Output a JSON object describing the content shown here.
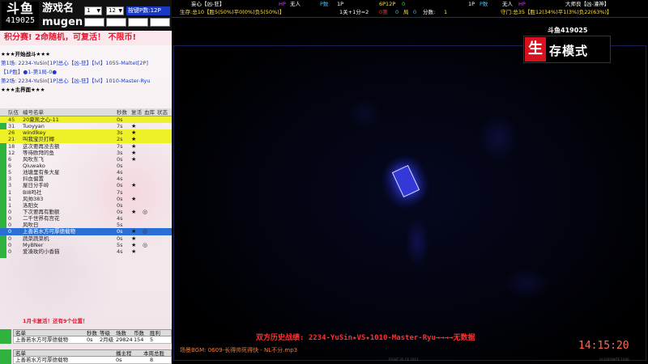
{
  "left_panel": {
    "logo_main": "斗鱼",
    "logo_num": "419025",
    "game_label": "游戏名",
    "engine_label": "mugen",
    "select_a": "1",
    "select_b": "12",
    "hotkey_label": "按键P数:12P",
    "options": [
      "",
      "",
      "",
      ""
    ],
    "score_banner": "积分赛! 2命随机，可复活！ 不限币!",
    "log_lines": [
      {
        "text": "★★★开始战斗★★★",
        "style": "black"
      },
      {
        "text": "第1场: 2234-YuSin[1P]总心【凶-狂】【lvl】1055-Maltet[2P]",
        "style": "blue"
      },
      {
        "text": "【1P胜】●1-第1局-0●",
        "style": "blue"
      },
      {
        "text": "第2场: 2234-YuSin[1P]总心【凶-狂】【lvl】1010-Master-Ryu",
        "style": "blue"
      },
      {
        "text": "★★★主界面★★★",
        "style": "black"
      }
    ],
    "roster_headers": [
      "队伍",
      "编号名单",
      "秒数",
      "复活",
      "血库",
      "状态"
    ],
    "roster": [
      {
        "idx": "45",
        "name": "20夏凯之心-11",
        "time": "0s",
        "star": "",
        "ring": "",
        "hl": "yellow"
      },
      {
        "idx": "31",
        "name": "Tuoyyan",
        "time": "7s",
        "star": "★",
        "ring": "",
        "hl": ""
      },
      {
        "idx": "26",
        "name": "windlkey",
        "time": "3s",
        "star": "★",
        "ring": "",
        "hl": "yellow"
      },
      {
        "idx": "21",
        "name": "叫我宝贝打椰",
        "time": "2s",
        "star": "★",
        "ring": "",
        "hl": "yellow"
      },
      {
        "idx": "18",
        "name": "这次要再没去额",
        "time": "7s",
        "star": "★",
        "ring": "",
        "hl": ""
      },
      {
        "idx": "12",
        "name": "等待欧拜的鱼",
        "time": "3s",
        "star": "★",
        "ring": "",
        "hl": ""
      },
      {
        "idx": "6",
        "name": "风吹东飞",
        "time": "0s",
        "star": "★",
        "ring": "",
        "hl": ""
      },
      {
        "idx": "6",
        "name": "Qiuwako",
        "time": "0s",
        "star": "",
        "ring": "",
        "hl": ""
      },
      {
        "idx": "5",
        "name": "池塘里有条大星",
        "time": "4s",
        "star": "",
        "ring": "",
        "hl": ""
      },
      {
        "idx": "3",
        "name": "抖血偏置",
        "time": "4s",
        "star": "",
        "ring": "",
        "hl": ""
      },
      {
        "idx": "3",
        "name": "屋日分手岭",
        "time": "0s",
        "star": "★",
        "ring": "",
        "hl": ""
      },
      {
        "idx": "1",
        "name": "BI8吗社",
        "time": "7s",
        "star": "",
        "ring": "",
        "hl": ""
      },
      {
        "idx": "1",
        "name": "风帅383",
        "time": "0s",
        "star": "★",
        "ring": "",
        "hl": ""
      },
      {
        "idx": "1",
        "name": "洛阳女",
        "time": "0s",
        "star": "",
        "ring": "",
        "hl": ""
      },
      {
        "idx": "0",
        "name": "下次要再有勤额",
        "time": "0s",
        "star": "★",
        "ring": "◎",
        "hl": ""
      },
      {
        "idx": "0",
        "name": "二千世界有宫花",
        "time": "4s",
        "star": "",
        "ring": "",
        "hl": ""
      },
      {
        "idx": "0",
        "name": "风吹日",
        "time": "5s",
        "star": "",
        "ring": "",
        "hl": ""
      },
      {
        "idx": "0",
        "name": "上善若水方可厚德载物",
        "time": "0s",
        "star": "★",
        "ring": "◎",
        "hl": "blue"
      },
      {
        "idx": "0",
        "name": "蔬菜蔬菜机",
        "time": "0s",
        "star": "★",
        "ring": "",
        "hl": ""
      },
      {
        "idx": "0",
        "name": "MyBNer",
        "time": "5s",
        "star": "★",
        "ring": "◎",
        "hl": ""
      },
      {
        "idx": "0",
        "name": "爱凑玫的小香猫",
        "time": "4s",
        "star": "★",
        "ring": "",
        "hl": ""
      }
    ],
    "tip": "1月卡复活！还有9个位置！",
    "table1_headers": [
      "名单",
      "秒数",
      "等级",
      "场数",
      "币数",
      "胜利"
    ],
    "table1_row": [
      "上善若水方可厚德载物",
      "0s",
      "2月级",
      "29824",
      "154",
      "5"
    ],
    "table2_headers": [
      "名单",
      "播主程",
      "本周总胜"
    ],
    "table2_row": [
      "上善若水方可厚德载物",
      "0s",
      "8"
    ]
  },
  "hud": {
    "p1_name": "妄心【凶-狂】",
    "p1_hp_label": "HP",
    "p1_status": "无人",
    "p1_p_label": "P数",
    "p1_p_value": "1P",
    "p1_life": "生存:总10【胜5(50%)平0(0%)负5(50%)】",
    "center_mode": "6P12P",
    "center_value": "0",
    "center_round": "1关+1分=2",
    "center_stage": "0第",
    "center_stage_val": "0",
    "center_rounds_label": "局",
    "center_rounds_val": "0",
    "center_score_label": "分数:",
    "center_score_val": "1",
    "p2_p_value": "1P",
    "p2_p_label": "P数",
    "p2_status": "无人",
    "p2_hp_label": "HP",
    "p2_name": "大师良【凶-灌神】",
    "p2_life": "守门:总35【胜12(34%)平1(3%)负22(63%)】"
  },
  "overlay": {
    "mode_num": "斗鱼419025",
    "mode_red": "生",
    "mode_text": "存模式",
    "history": "双方历史战绩: 2234-YuSin★VS★1010-Master-Ryu→→→→无数据",
    "bgm": "场景BGM: 0609-长得帅死得快 - NL不分.mp3",
    "clock": "14:15:20",
    "footer_a": "FIGHT 35 CE 2013",
    "footer_b": "VI ELEFANTE 1000"
  }
}
